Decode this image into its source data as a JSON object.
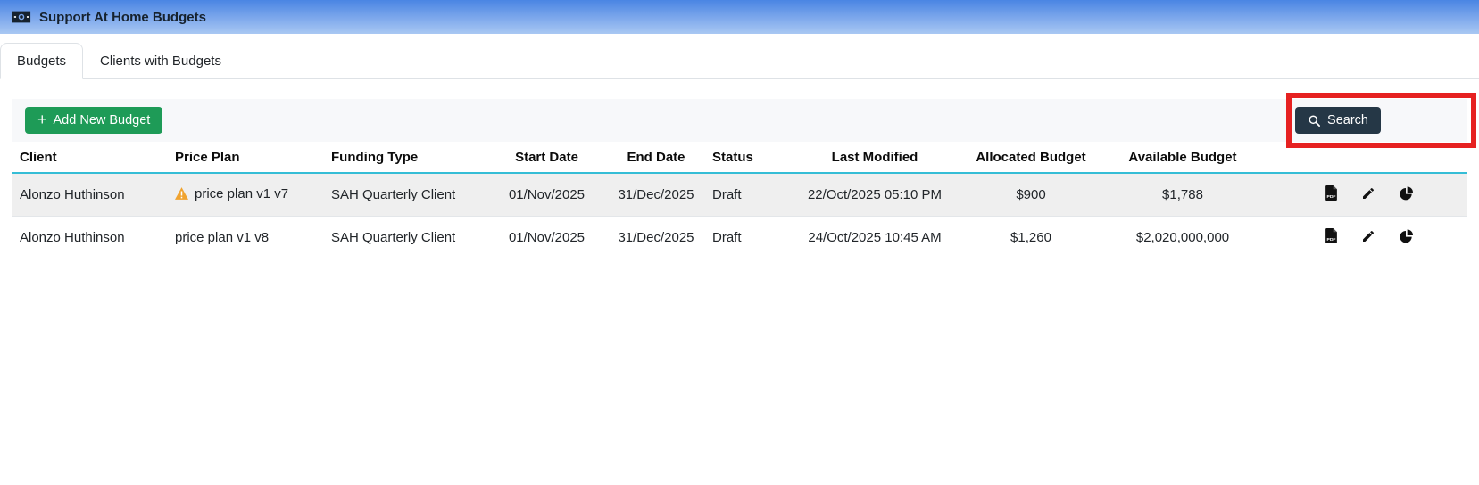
{
  "appbar": {
    "title": "Support At Home Budgets",
    "icon": "money-bill-icon"
  },
  "tabs": [
    {
      "label": "Budgets",
      "active": true
    },
    {
      "label": "Clients with Budgets",
      "active": false
    }
  ],
  "toolbar": {
    "add_button_label": "Add New Budget",
    "search_button_label": "Search"
  },
  "table": {
    "columns": [
      "Client",
      "Price Plan",
      "Funding Type",
      "Start Date",
      "End Date",
      "Status",
      "Last Modified",
      "Allocated Budget",
      "Available Budget"
    ],
    "rows": [
      {
        "client": "Alonzo Huthinson",
        "price_plan": "price plan v1 v7",
        "price_plan_warning": true,
        "funding_type": "SAH Quarterly Client",
        "start_date": "01/Nov/2025",
        "end_date": "31/Dec/2025",
        "status": "Draft",
        "last_modified": "22/Oct/2025 05:10 PM",
        "allocated_budget": "$900",
        "available_budget": "$1,788"
      },
      {
        "client": "Alonzo Huthinson",
        "price_plan": "price plan v1 v8",
        "price_plan_warning": false,
        "funding_type": "SAH Quarterly Client",
        "start_date": "01/Nov/2025",
        "end_date": "31/Dec/2025",
        "status": "Draft",
        "last_modified": "24/Oct/2025 10:45 AM",
        "allocated_budget": "$1,260",
        "available_budget": "$2,020,000,000"
      }
    ],
    "row_action_icons": [
      "export-pdf-icon",
      "edit-pencil-icon",
      "budget-pie-chart-icon"
    ]
  },
  "annotation": {
    "type": "highlight-box",
    "target": "search-button",
    "color": "#e62121"
  },
  "colors": {
    "appbar_gradient_top": "#4a85e3",
    "appbar_gradient_bottom": "#a9c8f3",
    "add_button": "#1e9b57",
    "search_button": "#253746",
    "table_header_border": "#35bdd6",
    "row_stripe": "#efefef",
    "warning_icon": "#f0a32f"
  }
}
